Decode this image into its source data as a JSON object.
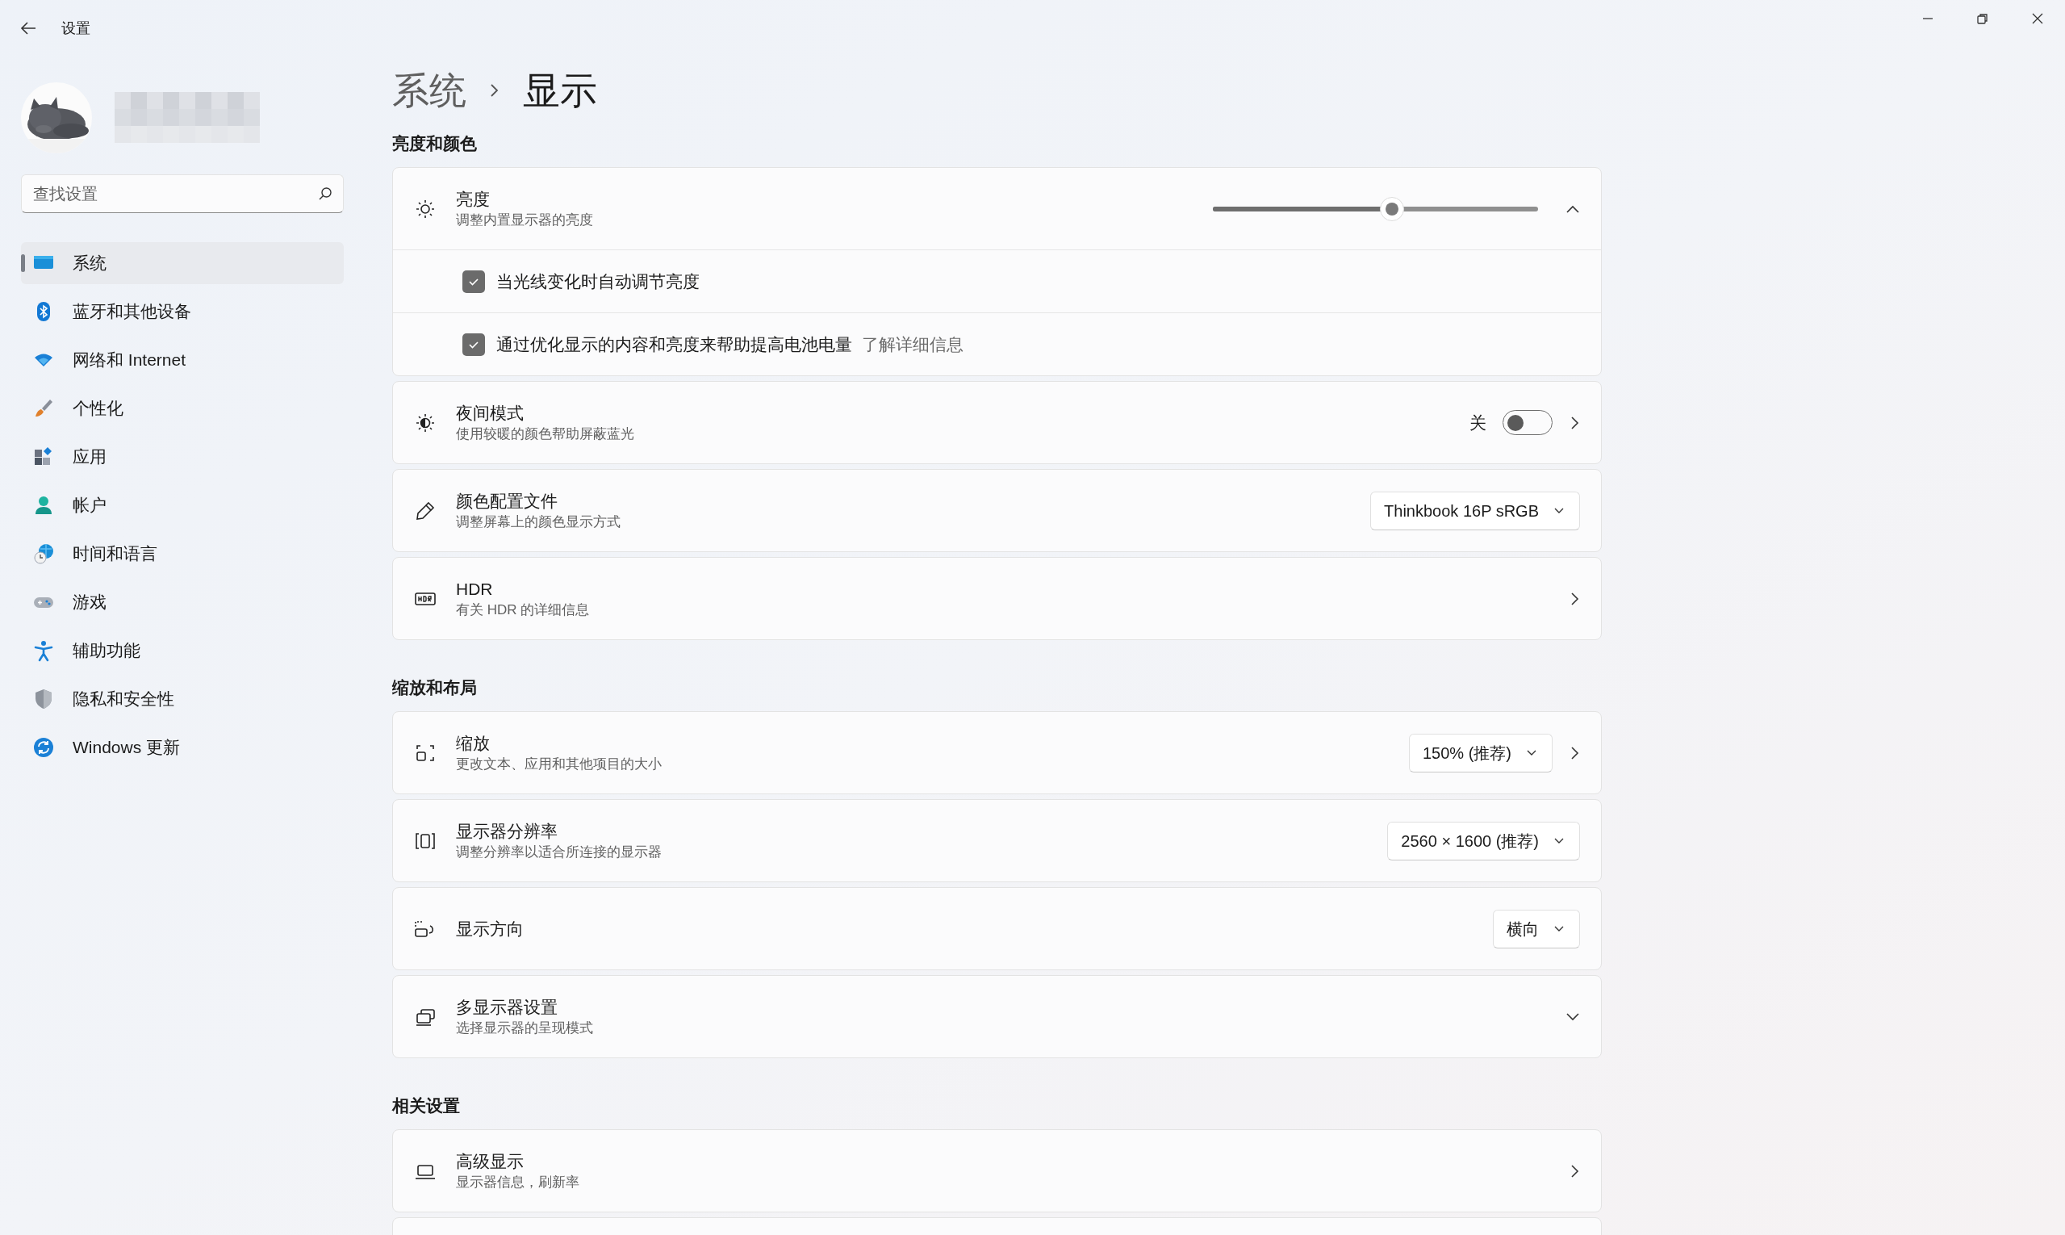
{
  "window": {
    "title": "设置"
  },
  "search": {
    "placeholder": "查找设置"
  },
  "sidebar": {
    "items": [
      {
        "label": "系统",
        "selected": true
      },
      {
        "label": "蓝牙和其他设备",
        "selected": false
      },
      {
        "label": "网络和 Internet",
        "selected": false
      },
      {
        "label": "个性化",
        "selected": false
      },
      {
        "label": "应用",
        "selected": false
      },
      {
        "label": "帐户",
        "selected": false
      },
      {
        "label": "时间和语言",
        "selected": false
      },
      {
        "label": "游戏",
        "selected": false
      },
      {
        "label": "辅助功能",
        "selected": false
      },
      {
        "label": "隐私和安全性",
        "selected": false
      },
      {
        "label": "Windows 更新",
        "selected": false
      }
    ]
  },
  "breadcrumb": [
    "系统",
    "显示"
  ],
  "sections": [
    {
      "title": "亮度和颜色",
      "cards": [
        {
          "kind": "slider",
          "title": "亮度",
          "subtitle": "调整内置显示器的亮度",
          "level": 0.55,
          "expanded": true,
          "rows": [
            {
              "label": "当光线变化时自动调节亮度",
              "checked": true
            },
            {
              "label": "通过优化显示的内容和亮度来帮助提高电池电量",
              "checked": true,
              "link": "了解详细信息"
            }
          ]
        },
        {
          "kind": "toggle",
          "title": "夜间模式",
          "subtitle": "使用较暖的颜色帮助屏蔽蓝光",
          "state_label": "关",
          "on": false,
          "navigates": true
        },
        {
          "kind": "dropdown",
          "title": "颜色配置文件",
          "subtitle": "调整屏幕上的颜色显示方式",
          "value": "Thinkbook 16P sRGB"
        },
        {
          "kind": "plain",
          "title": "HDR",
          "subtitle": "有关 HDR 的详细信息",
          "navigates": true
        }
      ]
    },
    {
      "title": "缩放和布局",
      "cards": [
        {
          "kind": "dropdown",
          "title": "缩放",
          "subtitle": "更改文本、应用和其他项目的大小",
          "value": "150% (推荐)",
          "navigates": true
        },
        {
          "kind": "dropdown",
          "title": "显示器分辨率",
          "subtitle": "调整分辨率以适合所连接的显示器",
          "value": "2560 × 1600 (推荐)"
        },
        {
          "kind": "dropdown",
          "title": "显示方向",
          "value": "横向"
        },
        {
          "kind": "plain",
          "title": "多显示器设置",
          "subtitle": "选择显示器的呈现模式",
          "expanded": false
        }
      ]
    },
    {
      "title": "相关设置",
      "cards": [
        {
          "kind": "plain",
          "title": "高级显示",
          "subtitle": "显示器信息，刷新率",
          "navigates": true
        }
      ]
    }
  ]
}
